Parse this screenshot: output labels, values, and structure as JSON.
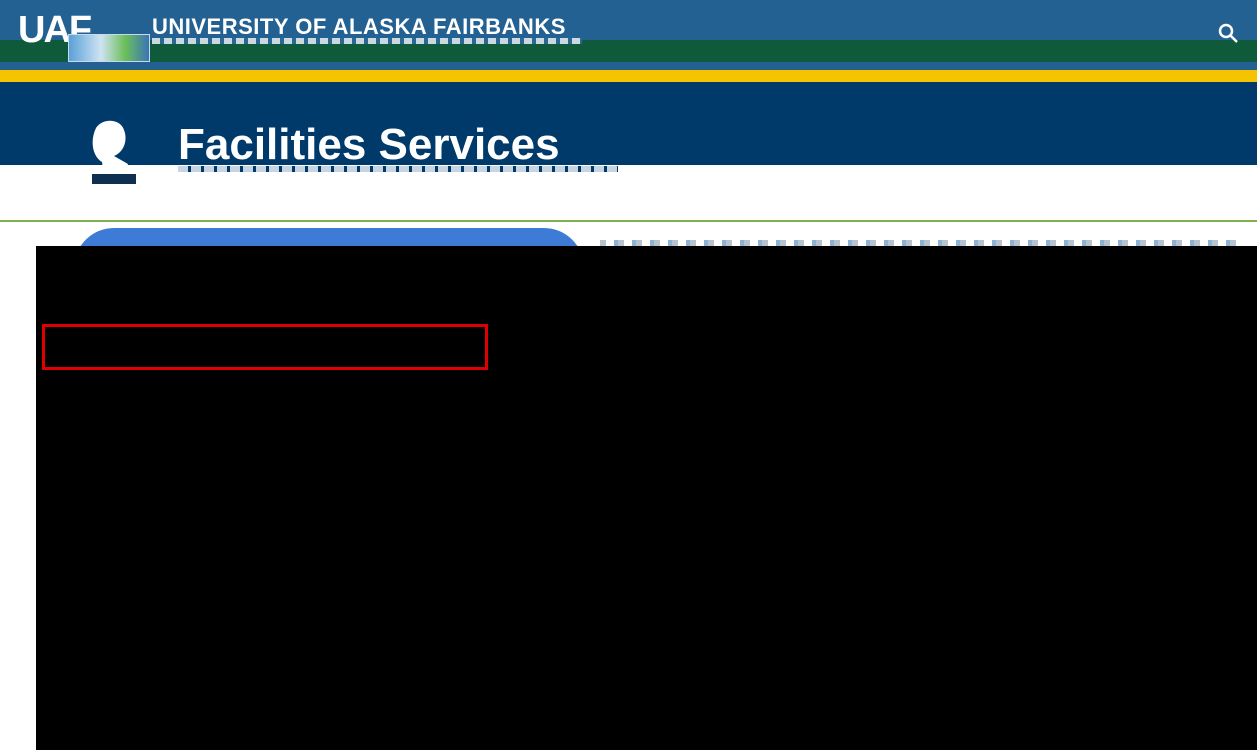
{
  "top_bar": {
    "university_name": "UNIVERSITY OF ALASKA FAIRBANKS",
    "logo_text": "UAF",
    "search_icon": "search-icon"
  },
  "banner": {
    "department_title": "Facilities Services",
    "seal_icon": "seal-icon"
  },
  "colors": {
    "topbar_blue": "#236192",
    "stripe_green": "#0e5a3b",
    "stripe_gold": "#f5c400",
    "banner_navy": "#003a6b",
    "highlight_red": "#e00000"
  }
}
